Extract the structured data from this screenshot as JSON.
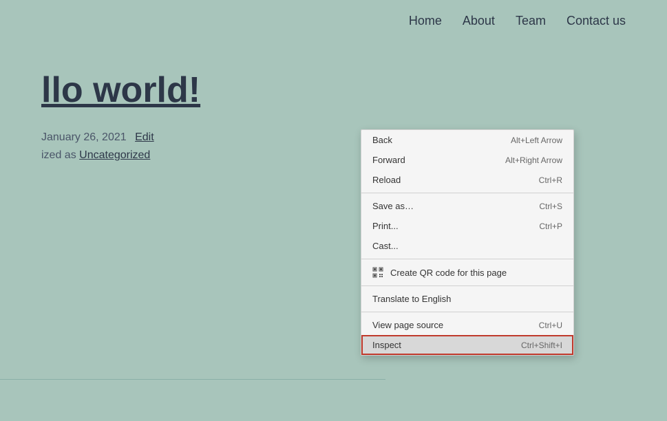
{
  "nav": {
    "links": [
      {
        "label": "Home",
        "id": "home"
      },
      {
        "label": "About",
        "id": "about"
      },
      {
        "label": "Team",
        "id": "team"
      },
      {
        "label": "Contact us",
        "id": "contact"
      }
    ]
  },
  "page": {
    "title": "llo world!",
    "date": "January 26, 2021",
    "edit_label": "Edit",
    "category_prefix": "ized as",
    "category": "Uncategorized"
  },
  "context_menu": {
    "items": [
      {
        "label": "Back",
        "shortcut": "Alt+Left Arrow",
        "id": "back",
        "highlighted": false
      },
      {
        "label": "Forward",
        "shortcut": "Alt+Right Arrow",
        "id": "forward",
        "highlighted": false
      },
      {
        "label": "Reload",
        "shortcut": "Ctrl+R",
        "id": "reload",
        "highlighted": false
      },
      {
        "separator": true
      },
      {
        "label": "Save as…",
        "shortcut": "Ctrl+S",
        "id": "save-as",
        "highlighted": false
      },
      {
        "label": "Print...",
        "shortcut": "Ctrl+P",
        "id": "print",
        "highlighted": false
      },
      {
        "label": "Cast...",
        "shortcut": "",
        "id": "cast",
        "highlighted": false
      },
      {
        "separator": true
      },
      {
        "label": "Create QR code for this page",
        "shortcut": "",
        "id": "qr-code",
        "has_icon": true,
        "highlighted": false
      },
      {
        "separator": true
      },
      {
        "label": "Translate to English",
        "shortcut": "",
        "id": "translate",
        "highlighted": false
      },
      {
        "separator": true
      },
      {
        "label": "View page source",
        "shortcut": "Ctrl+U",
        "id": "view-source",
        "highlighted": false
      },
      {
        "label": "Inspect",
        "shortcut": "Ctrl+Shift+I",
        "id": "inspect",
        "highlighted": true
      }
    ]
  }
}
